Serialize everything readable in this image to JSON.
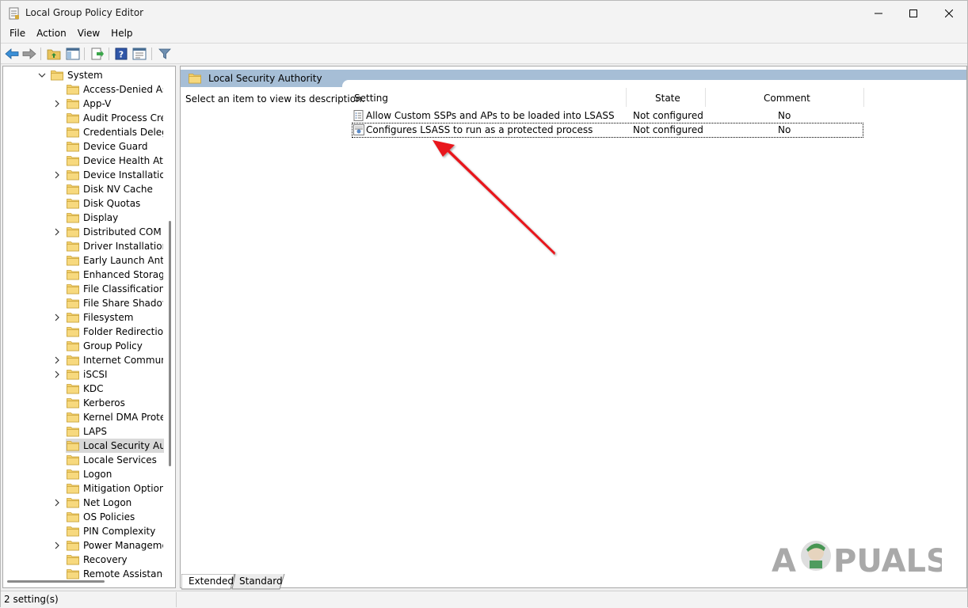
{
  "window": {
    "title": "Local Group Policy Editor"
  },
  "menu": [
    "File",
    "Action",
    "View",
    "Help"
  ],
  "tree": {
    "root": "System",
    "items": [
      {
        "label": "Access-Denied Ass",
        "expandable": false
      },
      {
        "label": "App-V",
        "expandable": true
      },
      {
        "label": "Audit Process Crea",
        "expandable": false
      },
      {
        "label": "Credentials Delegat",
        "expandable": false
      },
      {
        "label": "Device Guard",
        "expandable": false
      },
      {
        "label": "Device Health Atte",
        "expandable": false
      },
      {
        "label": "Device Installation",
        "expandable": true
      },
      {
        "label": "Disk NV Cache",
        "expandable": false
      },
      {
        "label": "Disk Quotas",
        "expandable": false
      },
      {
        "label": "Display",
        "expandable": false
      },
      {
        "label": "Distributed COM",
        "expandable": true
      },
      {
        "label": "Driver Installation",
        "expandable": false
      },
      {
        "label": "Early Launch Antim",
        "expandable": false
      },
      {
        "label": "Enhanced Storage A",
        "expandable": false
      },
      {
        "label": "File Classification I",
        "expandable": false
      },
      {
        "label": "File Share Shadow C",
        "expandable": false
      },
      {
        "label": "Filesystem",
        "expandable": true
      },
      {
        "label": "Folder Redirection",
        "expandable": false
      },
      {
        "label": "Group Policy",
        "expandable": false
      },
      {
        "label": "Internet Communic",
        "expandable": true
      },
      {
        "label": "iSCSI",
        "expandable": true
      },
      {
        "label": "KDC",
        "expandable": false
      },
      {
        "label": "Kerberos",
        "expandable": false
      },
      {
        "label": "Kernel DMA Protec",
        "expandable": false
      },
      {
        "label": "LAPS",
        "expandable": false
      },
      {
        "label": "Local Security Auth",
        "expandable": false,
        "selected": true
      },
      {
        "label": "Locale Services",
        "expandable": false
      },
      {
        "label": "Logon",
        "expandable": false
      },
      {
        "label": "Mitigation Options",
        "expandable": false
      },
      {
        "label": "Net Logon",
        "expandable": true
      },
      {
        "label": "OS Policies",
        "expandable": false
      },
      {
        "label": "PIN Complexity",
        "expandable": false
      },
      {
        "label": "Power Managemer",
        "expandable": true
      },
      {
        "label": "Recovery",
        "expandable": false
      },
      {
        "label": "Remote Assistance",
        "expandable": false
      }
    ]
  },
  "details": {
    "header": "Local Security Authority",
    "description": "Select an item to view its description.",
    "columns": {
      "setting": "Setting",
      "state": "State",
      "comment": "Comment"
    },
    "rows": [
      {
        "setting": "Allow Custom SSPs and APs to be loaded into LSASS",
        "state": "Not configured",
        "comment": "No",
        "icon": "policy-setting-icon"
      },
      {
        "setting": "Configures LSASS to run as a protected process",
        "state": "Not configured",
        "comment": "No",
        "icon": "policy-setting-icon",
        "focused": true
      }
    ]
  },
  "tabs": [
    "Extended",
    "Standard"
  ],
  "status": "2 setting(s)",
  "watermark": {
    "text": "APPUALS"
  },
  "colors": {
    "header_band": "#a6bed6",
    "arrow": "#e8161b",
    "folder": "#f0c14b"
  }
}
